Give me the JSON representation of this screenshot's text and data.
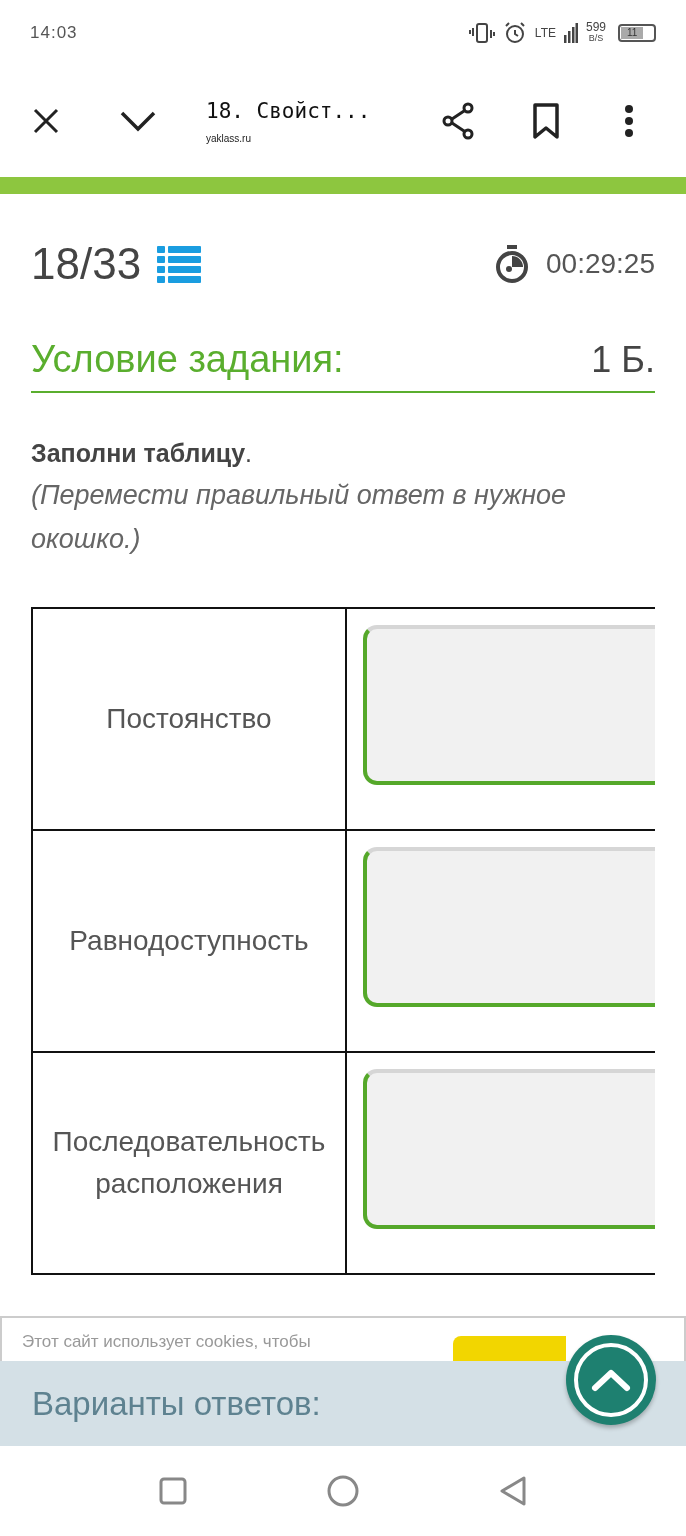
{
  "status_bar": {
    "time": "14:03",
    "network": "LTE",
    "speed": "599",
    "speed_unit": "B/S",
    "battery": "11"
  },
  "toolbar": {
    "title": "18. Свойст...",
    "url": "yaklass.ru"
  },
  "progress": {
    "counter": "18/33",
    "timer": "00:29:25"
  },
  "task": {
    "heading": "Условие задания:",
    "points": "1 Б.",
    "instruction_bold": "Заполни таблицу",
    "instruction_end": ".",
    "hint": "(Перемести правильный ответ в нужное окошко.)"
  },
  "table": {
    "rows": [
      {
        "label": "Постоянство"
      },
      {
        "label": "Равнодоступность"
      },
      {
        "label": "Последовательность расположения"
      }
    ]
  },
  "cookie_banner": {
    "text": "Этот сайт использует cookies, чтобы"
  },
  "answers_panel": {
    "title": "Варианты ответов:"
  }
}
